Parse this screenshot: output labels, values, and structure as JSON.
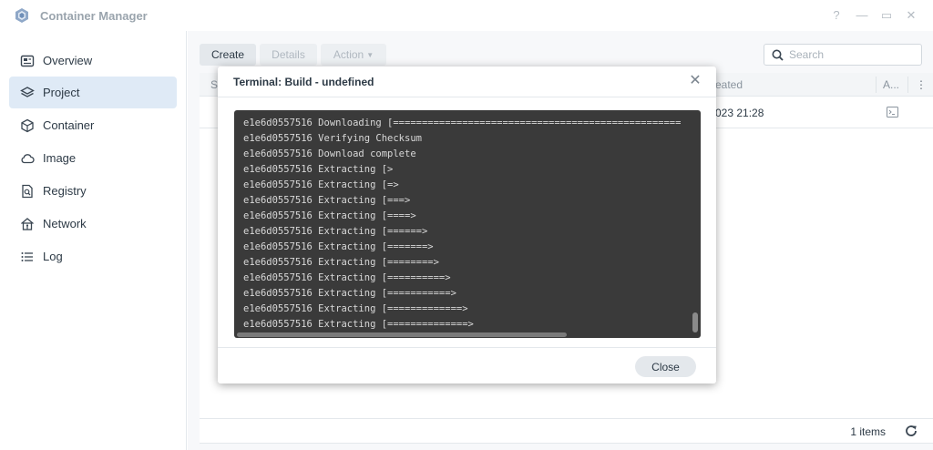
{
  "app": {
    "title": "Container Manager"
  },
  "window_controls": {
    "help": "?",
    "minimize": "—",
    "maximize": "▭",
    "close": "✕"
  },
  "sidebar": {
    "items": [
      {
        "label": "Overview",
        "icon": "overview-icon",
        "active": false
      },
      {
        "label": "Project",
        "icon": "project-icon",
        "active": true
      },
      {
        "label": "Container",
        "icon": "container-icon",
        "active": false
      },
      {
        "label": "Image",
        "icon": "image-icon",
        "active": false
      },
      {
        "label": "Registry",
        "icon": "registry-icon",
        "active": false
      },
      {
        "label": "Network",
        "icon": "network-icon",
        "active": false
      },
      {
        "label": "Log",
        "icon": "log-icon",
        "active": false
      }
    ]
  },
  "toolbar": {
    "create_label": "Create",
    "details_label": "Details",
    "action_label": "Action",
    "search_placeholder": "Search"
  },
  "table": {
    "headers": {
      "status_partial": "S",
      "created_partial": "eated",
      "actions_partial": "A..."
    },
    "rows": [
      {
        "created": "023 21:28"
      }
    ]
  },
  "footer": {
    "count": "1 items"
  },
  "dialog": {
    "title": "Terminal: Build - undefined",
    "close_button": "Close",
    "terminal_lines": [
      "e1e6d0557516 Downloading [==================================================",
      "e1e6d0557516 Verifying Checksum",
      "e1e6d0557516 Download complete",
      "e1e6d0557516 Extracting [>",
      "e1e6d0557516 Extracting [=>",
      "e1e6d0557516 Extracting [===>",
      "e1e6d0557516 Extracting [====>",
      "e1e6d0557516 Extracting [======>",
      "e1e6d0557516 Extracting [=======>",
      "e1e6d0557516 Extracting [========>",
      "e1e6d0557516 Extracting [==========>",
      "e1e6d0557516 Extracting [===========>",
      "e1e6d0557516 Extracting [=============>",
      "e1e6d0557516 Extracting [==============>"
    ]
  },
  "colors": {
    "accent_active_bg": "#dfeaf6",
    "terminal_bg": "#3a3a3a",
    "terminal_text": "#d8d8d8"
  }
}
